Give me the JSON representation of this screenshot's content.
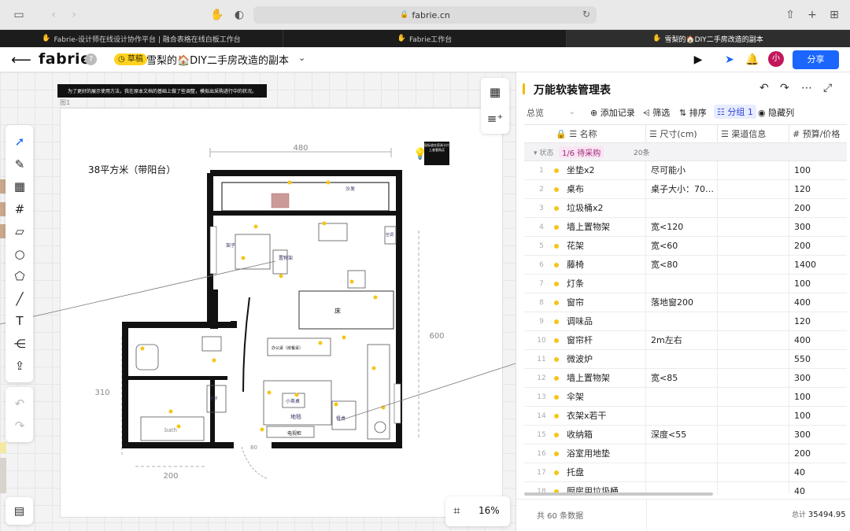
{
  "browser": {
    "url": "fabrie.cn",
    "tabs": [
      {
        "label": "Fabrie-设计师在线设计协作平台 | 融合表格在线白板工作台",
        "active": false
      },
      {
        "label": "Fabrie工作台",
        "active": false
      },
      {
        "label": "雪梨的🏠DIY二手房改造的副本",
        "active": true
      }
    ]
  },
  "header": {
    "logo": "fabrie",
    "help": "?",
    "draft_badge": "草稿",
    "doc_title": "雪梨的🏠DIY二手房改造的副本",
    "avatar": "小",
    "share_label": "分享"
  },
  "canvas": {
    "note_banner": "为了更好的展示使用方法，我在原本文档的基础上做了些调整，模拟出采购进行中的状况。",
    "frame_label": "图1",
    "zoom": "16%"
  },
  "floorplan": {
    "title": "38平方米（带阳台）",
    "dims": [
      "480",
      "600",
      "310",
      "200",
      "80"
    ],
    "note_box": "鼠标放在家具卡片上查看购买",
    "rooms": {
      "bed": "床",
      "desk": "办公桌（房餐桌）",
      "rug": "地毯",
      "small_table": "小茶桌",
      "tv": "电视柜",
      "dining": "餐桌",
      "bath": "bath",
      "shelf": "架子",
      "plant_shelf": "置物架",
      "ac": "空调",
      "cabinet": "柜子",
      "sofa": "沙发"
    }
  },
  "panel": {
    "title": "万能软装管理表",
    "view": "总览",
    "toolbar": {
      "add": "添加记录",
      "filter": "筛选",
      "sort": "排序",
      "group": "分组 1",
      "hide": "隐藏列"
    },
    "columns": [
      "名称",
      "尺寸(cm)",
      "渠道信息",
      "预算/价格"
    ],
    "group": {
      "label": "状态",
      "badge": "1/6 待采购",
      "count": "20条"
    },
    "rows": [
      {
        "idx": "1",
        "name": "坐垫x2",
        "size": "尽可能小",
        "budget": "100"
      },
      {
        "idx": "2",
        "name": "桌布",
        "size": "桌子大小：70…",
        "budget": "120"
      },
      {
        "idx": "3",
        "name": "垃圾桶x2",
        "size": "",
        "budget": "200"
      },
      {
        "idx": "4",
        "name": "墙上置物架",
        "size": "宽<120",
        "budget": "300"
      },
      {
        "idx": "5",
        "name": "花架",
        "size": "宽<60",
        "budget": "200"
      },
      {
        "idx": "6",
        "name": "藤椅",
        "size": "宽<80",
        "budget": "1400"
      },
      {
        "idx": "7",
        "name": "灯条",
        "size": "",
        "budget": "100"
      },
      {
        "idx": "8",
        "name": "窗帘",
        "size": "落地窗200",
        "budget": "400"
      },
      {
        "idx": "9",
        "name": "调味品",
        "size": "",
        "budget": "120"
      },
      {
        "idx": "10",
        "name": "窗帘杆",
        "size": "2m左右",
        "budget": "400"
      },
      {
        "idx": "11",
        "name": "微波炉",
        "size": "",
        "budget": "550"
      },
      {
        "idx": "12",
        "name": "墙上置物架",
        "size": "宽<85",
        "budget": "300"
      },
      {
        "idx": "13",
        "name": "伞架",
        "size": "",
        "budget": "100"
      },
      {
        "idx": "14",
        "name": "衣架x若干",
        "size": "",
        "budget": "100"
      },
      {
        "idx": "15",
        "name": "收纳箱",
        "size": "深度<55",
        "budget": "300"
      },
      {
        "idx": "16",
        "name": "浴室用地垫",
        "size": "",
        "budget": "200"
      },
      {
        "idx": "17",
        "name": "托盘",
        "size": "",
        "budget": "40"
      },
      {
        "idx": "18",
        "name": "厨房用垃圾桶",
        "size": "",
        "budget": "40"
      }
    ],
    "footer": {
      "total_records": "共 60 条数据",
      "sum_label": "总计",
      "sum_value": "35494.95"
    }
  }
}
